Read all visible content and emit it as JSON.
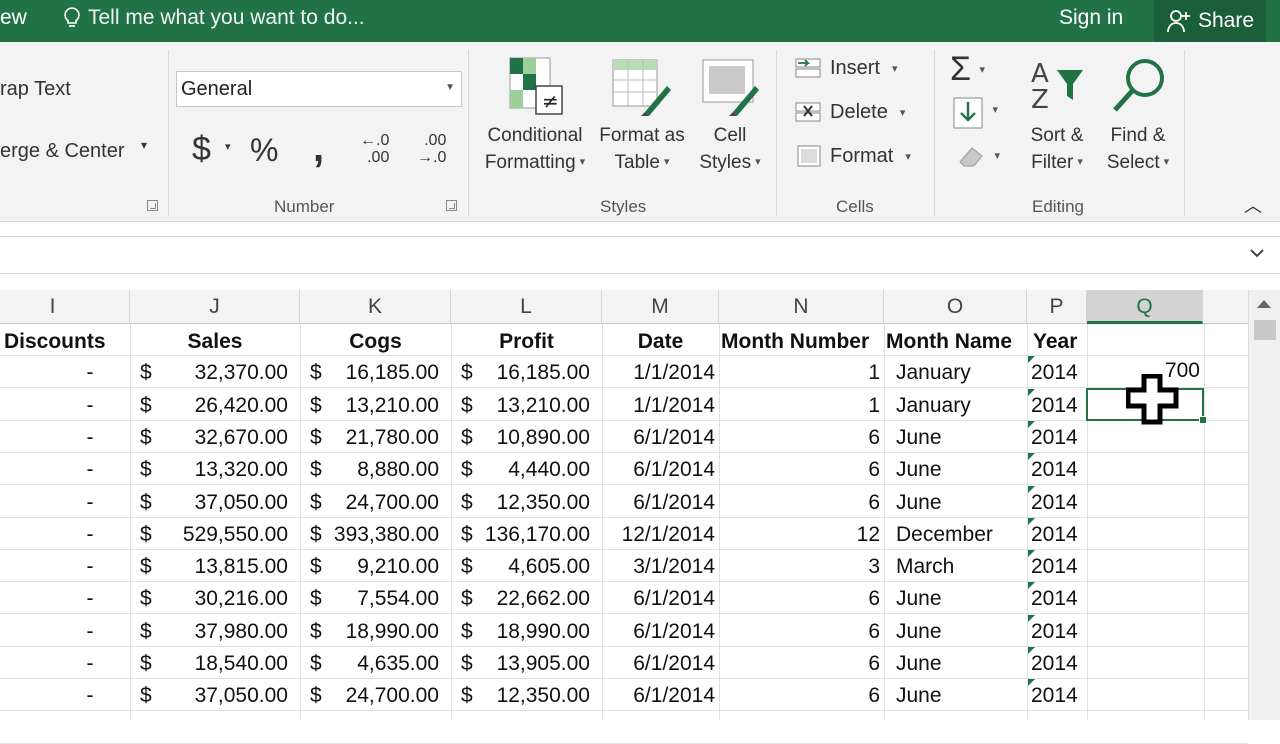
{
  "titlebar": {
    "view_tab": "ew",
    "tell_me": "Tell me what you want to do...",
    "sign_in": "Sign in",
    "share": "Share"
  },
  "ribbon": {
    "alignment": {
      "wrap_text": "rap Text",
      "merge_center": "erge & Center"
    },
    "number": {
      "format_value": "General",
      "group_label": "Number",
      "currency": "$",
      "percent": "%",
      "comma": ",",
      "inc_decimal_top": "←.0",
      "inc_decimal_bottom": ".00",
      "dec_decimal_top": ".00",
      "dec_decimal_bottom": "→.0"
    },
    "styles": {
      "group_label": "Styles",
      "conditional_1": "Conditional",
      "conditional_2": "Formatting",
      "format_table_1": "Format as",
      "format_table_2": "Table",
      "cell_styles_1": "Cell",
      "cell_styles_2": "Styles"
    },
    "cells": {
      "group_label": "Cells",
      "insert": "Insert",
      "delete": "Delete",
      "format": "Format"
    },
    "editing": {
      "group_label": "Editing",
      "sort_1": "Sort &",
      "sort_2": "Filter",
      "find_1": "Find &",
      "find_2": "Select"
    }
  },
  "sheet": {
    "columns": [
      {
        "letter": "I",
        "header": "Discounts"
      },
      {
        "letter": "J",
        "header": "Sales"
      },
      {
        "letter": "K",
        "header": "Cogs"
      },
      {
        "letter": "L",
        "header": "Profit"
      },
      {
        "letter": "M",
        "header": "Date"
      },
      {
        "letter": "N",
        "header": "Month Number"
      },
      {
        "letter": "O",
        "header": "Month Name"
      },
      {
        "letter": "P",
        "header": "Year"
      },
      {
        "letter": "Q",
        "header": ""
      }
    ],
    "selected_column": "Q",
    "q_cell_value": "700",
    "rows": [
      {
        "discount": "-",
        "sales": "32,370.00",
        "cogs": "16,185.00",
        "profit": "16,185.00",
        "date": "1/1/2014",
        "month_num": "1",
        "month_name": "January",
        "year": "2014"
      },
      {
        "discount": "-",
        "sales": "26,420.00",
        "cogs": "13,210.00",
        "profit": "13,210.00",
        "date": "1/1/2014",
        "month_num": "1",
        "month_name": "January",
        "year": "2014"
      },
      {
        "discount": "-",
        "sales": "32,670.00",
        "cogs": "21,780.00",
        "profit": "10,890.00",
        "date": "6/1/2014",
        "month_num": "6",
        "month_name": "June",
        "year": "2014"
      },
      {
        "discount": "-",
        "sales": "13,320.00",
        "cogs": "8,880.00",
        "profit": "4,440.00",
        "date": "6/1/2014",
        "month_num": "6",
        "month_name": "June",
        "year": "2014"
      },
      {
        "discount": "-",
        "sales": "37,050.00",
        "cogs": "24,700.00",
        "profit": "12,350.00",
        "date": "6/1/2014",
        "month_num": "6",
        "month_name": "June",
        "year": "2014"
      },
      {
        "discount": "-",
        "sales": "529,550.00",
        "cogs": "393,380.00",
        "profit": "136,170.00",
        "date": "12/1/2014",
        "month_num": "12",
        "month_name": "December",
        "year": "2014"
      },
      {
        "discount": "-",
        "sales": "13,815.00",
        "cogs": "9,210.00",
        "profit": "4,605.00",
        "date": "3/1/2014",
        "month_num": "3",
        "month_name": "March",
        "year": "2014"
      },
      {
        "discount": "-",
        "sales": "30,216.00",
        "cogs": "7,554.00",
        "profit": "22,662.00",
        "date": "6/1/2014",
        "month_num": "6",
        "month_name": "June",
        "year": "2014"
      },
      {
        "discount": "-",
        "sales": "37,980.00",
        "cogs": "18,990.00",
        "profit": "18,990.00",
        "date": "6/1/2014",
        "month_num": "6",
        "month_name": "June",
        "year": "2014"
      },
      {
        "discount": "-",
        "sales": "18,540.00",
        "cogs": "4,635.00",
        "profit": "13,905.00",
        "date": "6/1/2014",
        "month_num": "6",
        "month_name": "June",
        "year": "2014"
      },
      {
        "discount": "-",
        "sales": "37,050.00",
        "cogs": "24,700.00",
        "profit": "12,350.00",
        "date": "6/1/2014",
        "month_num": "6",
        "month_name": "June",
        "year": "2014"
      }
    ],
    "currency_symbol": "$"
  },
  "colors": {
    "accent": "#217346",
    "ribbon": "#f3f3f3"
  }
}
